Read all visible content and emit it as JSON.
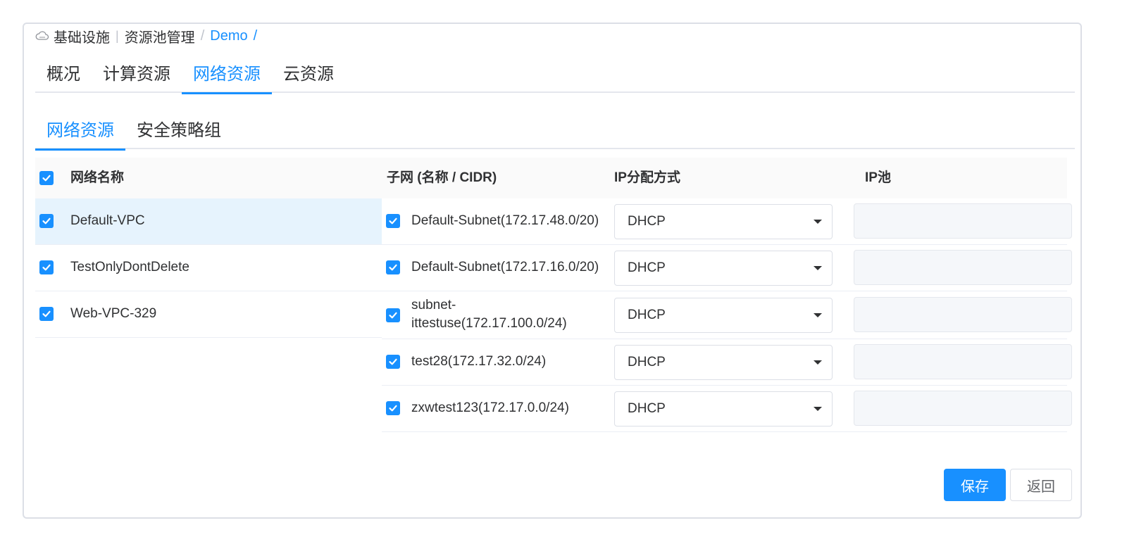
{
  "breadcrumb": {
    "icon": "cloud-icon",
    "items": [
      "基础设施",
      "资源池管理",
      "Demo"
    ],
    "separator_bar": "|",
    "separator_slash": "/"
  },
  "tabs_top": [
    "概况",
    "计算资源",
    "网络资源",
    "云资源"
  ],
  "tabs_top_active": "网络资源",
  "tabs_sub": [
    "网络资源",
    "安全策略组"
  ],
  "tabs_sub_active": "网络资源",
  "table": {
    "headers": {
      "network_name": "网络名称",
      "subnet": "子网 (名称 / CIDR)",
      "ip_method": "IP分配方式",
      "ip_pool": "IP池"
    },
    "networks": [
      "Default-VPC",
      "TestOnlyDontDelete",
      "Web-VPC-329"
    ],
    "subnets": [
      {
        "name": "Default-Subnet(172.17.48.0/20)",
        "method": "DHCP",
        "pool": ""
      },
      {
        "name": "Default-Subnet(172.17.16.0/20)",
        "method": "DHCP",
        "pool": ""
      },
      {
        "name": "subnet-ittestuse(172.17.100.0/24)",
        "name_line1": "subnet-",
        "name_line2": "ittestuse(172.17.100.0/24)",
        "method": "DHCP",
        "pool": ""
      },
      {
        "name": "test28(172.17.32.0/24)",
        "method": "DHCP",
        "pool": ""
      },
      {
        "name": "zxwtest123(172.17.0.0/24)",
        "method": "DHCP",
        "pool": ""
      }
    ]
  },
  "buttons": {
    "save": "保存",
    "back": "返回"
  },
  "colors": {
    "primary": "#1890ff",
    "selected_row": "#e6f3fd",
    "header_bg": "#fafafa"
  }
}
